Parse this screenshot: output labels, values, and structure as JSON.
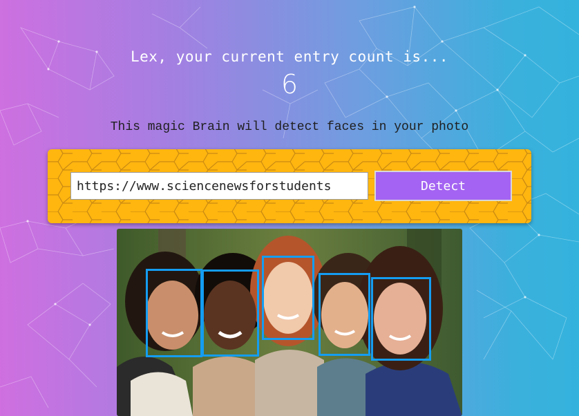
{
  "header": {
    "entry_count_text": "Lex, your current entry count is...",
    "entry_count": "6"
  },
  "tagline": "This magic Brain will detect faces in your photo",
  "form": {
    "url_value": "https://www.sciencenewsforstudents",
    "detect_label": "Detect"
  },
  "colors": {
    "panel": "#ffb60f",
    "button": "#a463f2",
    "face_box": "#149df2"
  },
  "detected_faces": 5
}
